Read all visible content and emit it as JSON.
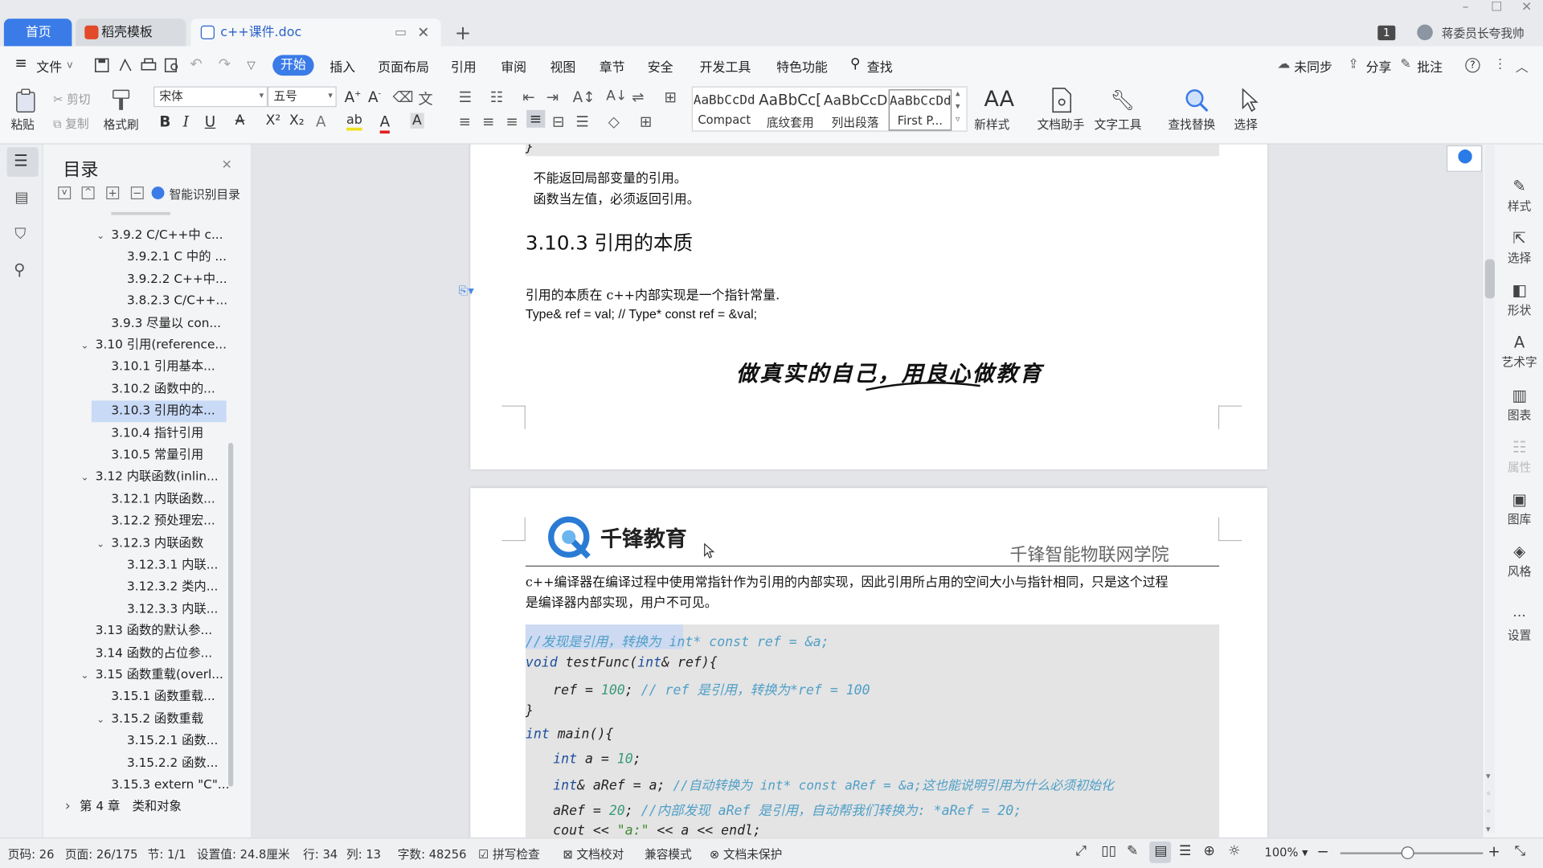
{
  "titlebar": {
    "tabs": [
      "首页",
      "稻壳模板",
      "c++课件.doc"
    ],
    "notif_count": "1",
    "user": "蒋委员长夸我帅"
  },
  "menu": {
    "file": "文件",
    "items": [
      "开始",
      "插入",
      "页面布局",
      "引用",
      "审阅",
      "视图",
      "章节",
      "安全",
      "开发工具",
      "特色功能"
    ],
    "search": "查找",
    "sync": "未同步",
    "share": "分享",
    "comment": "批注"
  },
  "ribbon": {
    "paste": "粘贴",
    "cut": "剪切",
    "copy": "复制",
    "format_painter": "格式刷",
    "font_name": "宋体",
    "font_size": "五号",
    "styles": [
      {
        "preview": "AaBbCcDd",
        "name": "Compact"
      },
      {
        "preview": "AaBbCc[",
        "name": "底纹套用"
      },
      {
        "preview": "AaBbCcD",
        "name": "列出段落"
      },
      {
        "preview": "AaBbCcDd",
        "name": "First P..."
      }
    ],
    "new_style": "新样式",
    "doc_assistant": "文档助手",
    "text_tools": "文字工具",
    "find_replace": "查找替换",
    "select": "选择"
  },
  "toc": {
    "title": "目录",
    "smart": "智能识别目录",
    "items": [
      {
        "text": "3.9.2 C/C++中 c...",
        "indent": 2,
        "chev": "v"
      },
      {
        "text": "3.9.2.1 C 中的 ...",
        "indent": 3,
        "chev": ""
      },
      {
        "text": "3.9.2.2 C++中...",
        "indent": 3,
        "chev": ""
      },
      {
        "text": "3.8.2.3 C/C++...",
        "indent": 3,
        "chev": ""
      },
      {
        "text": "3.9.3 尽量以 con...",
        "indent": 2,
        "chev": ""
      },
      {
        "text": "3.10 引用(reference...",
        "indent": 1,
        "chev": "v"
      },
      {
        "text": "3.10.1 引用基本...",
        "indent": 2,
        "chev": ""
      },
      {
        "text": "3.10.2 函数中的...",
        "indent": 2,
        "chev": ""
      },
      {
        "text": "3.10.3 引用的本...",
        "indent": 2,
        "chev": ""
      },
      {
        "text": "3.10.4 指针引用",
        "indent": 2,
        "chev": ""
      },
      {
        "text": "3.10.5 常量引用",
        "indent": 2,
        "chev": ""
      },
      {
        "text": "3.12 内联函数(inlin...",
        "indent": 1,
        "chev": "v"
      },
      {
        "text": "3.12.1 内联函数...",
        "indent": 2,
        "chev": ""
      },
      {
        "text": "3.12.2 预处理宏...",
        "indent": 2,
        "chev": ""
      },
      {
        "text": "3.12.3 内联函数",
        "indent": 2,
        "chev": "v"
      },
      {
        "text": "3.12.3.1 内联...",
        "indent": 3,
        "chev": ""
      },
      {
        "text": "3.12.3.2 类内...",
        "indent": 3,
        "chev": ""
      },
      {
        "text": "3.12.3.3 内联...",
        "indent": 3,
        "chev": ""
      },
      {
        "text": "3.13 函数的默认参...",
        "indent": 1,
        "chev": ""
      },
      {
        "text": "3.14 函数的占位参...",
        "indent": 1,
        "chev": ""
      },
      {
        "text": "3.15 函数重载(overl...",
        "indent": 1,
        "chev": "v"
      },
      {
        "text": "3.15.1 函数重载...",
        "indent": 2,
        "chev": ""
      },
      {
        "text": "3.15.2 函数重载",
        "indent": 2,
        "chev": "v"
      },
      {
        "text": "3.15.2.1 函数...",
        "indent": 3,
        "chev": ""
      },
      {
        "text": "3.15.2.2 函数...",
        "indent": 3,
        "chev": ""
      },
      {
        "text": "3.15.3 extern \"C\"...",
        "indent": 2,
        "chev": ""
      },
      {
        "text": "第 4 章　类和对象",
        "indent": 0,
        "chev": ">"
      }
    ]
  },
  "doc": {
    "p1_line1": "不能返回局部变量的引用。",
    "p1_line2": "函数当左值，必须返回引用。",
    "heading": "3.10.3  引用的本质",
    "p2": "引用的本质在 c++内部实现是一个指针常量.",
    "p3": "Type& ref = val; // Type* const ref = &val;",
    "footer_slogan": "做真实的自己，用良心做教育",
    "logo_text": "千锋教育",
    "header_right": "千锋智能物联网学院",
    "p4_line1": "c++编译器在编译过程中使用常指针作为引用的内部实现，因此引用所占用的空间大小与指针相同，只是这个过程",
    "p4_line2": "是编译器内部实现，用户不可见。",
    "code": {
      "c1": "//发现是引用，转换为 int* const ref = &a;",
      "c2a": "void",
      "c2b": " testFunc(",
      "c2c": "int",
      "c2d": "& ref){",
      "c3a": "ref = ",
      "c3b": "100",
      "c3c": "; ",
      "c3d": "// ref 是引用，转换为*ref = 100",
      "c4": "}",
      "c5a": "int",
      "c5b": " main(){",
      "c6a": "int",
      "c6b": " a = ",
      "c6c": "10",
      "c6d": ";",
      "c7a": "int",
      "c7b": "& aRef = a; ",
      "c7c": "//自动转换为 int* const aRef = &a;这也能说明引用为什么必须初始化",
      "c8a": "aRef = ",
      "c8b": "20",
      "c8c": "; ",
      "c8d": "//内部发现 aRef 是引用，自动帮我们转换为: *aRef = 20;",
      "c9a": "cout << ",
      "c9b": "\"a:\"",
      "c9c": " << a << endl;"
    }
  },
  "rightbar": [
    "样式",
    "选择",
    "形状",
    "艺术字",
    "图表",
    "属性",
    "图库",
    "风格",
    "设置"
  ],
  "status": {
    "page": "页码: 26",
    "pages": "页面: 26/175",
    "section": "节: 1/1",
    "setting": "设置值: 24.8厘米",
    "row": "行: 34",
    "col": "列: 13",
    "words": "字数: 48256",
    "spell": "拼写检查",
    "proof": "文档校对",
    "compat": "兼容模式",
    "protect": "文档未保护",
    "zoom": "100%"
  }
}
